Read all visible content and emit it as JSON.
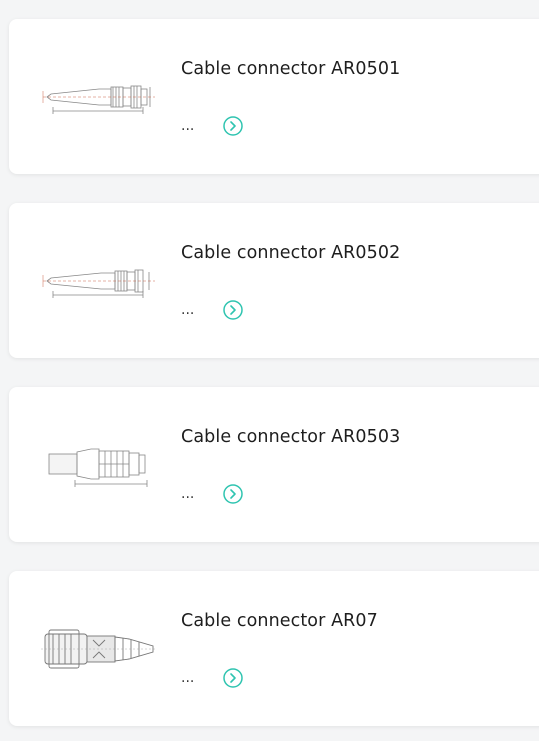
{
  "accent_color": "#2fc4b0",
  "products": [
    {
      "title": "Cable connector AR0501",
      "description": "...",
      "icon": "chevron-right-circle-icon",
      "image": "ar0501-drawing"
    },
    {
      "title": "Cable connector AR0502",
      "description": "...",
      "icon": "chevron-right-circle-icon",
      "image": "ar0502-drawing"
    },
    {
      "title": "Cable connector AR0503",
      "description": "...",
      "icon": "chevron-right-circle-icon",
      "image": "ar0503-drawing"
    },
    {
      "title": "Cable connector AR07",
      "description": "...",
      "icon": "chevron-right-circle-icon",
      "image": "ar07-drawing"
    }
  ]
}
